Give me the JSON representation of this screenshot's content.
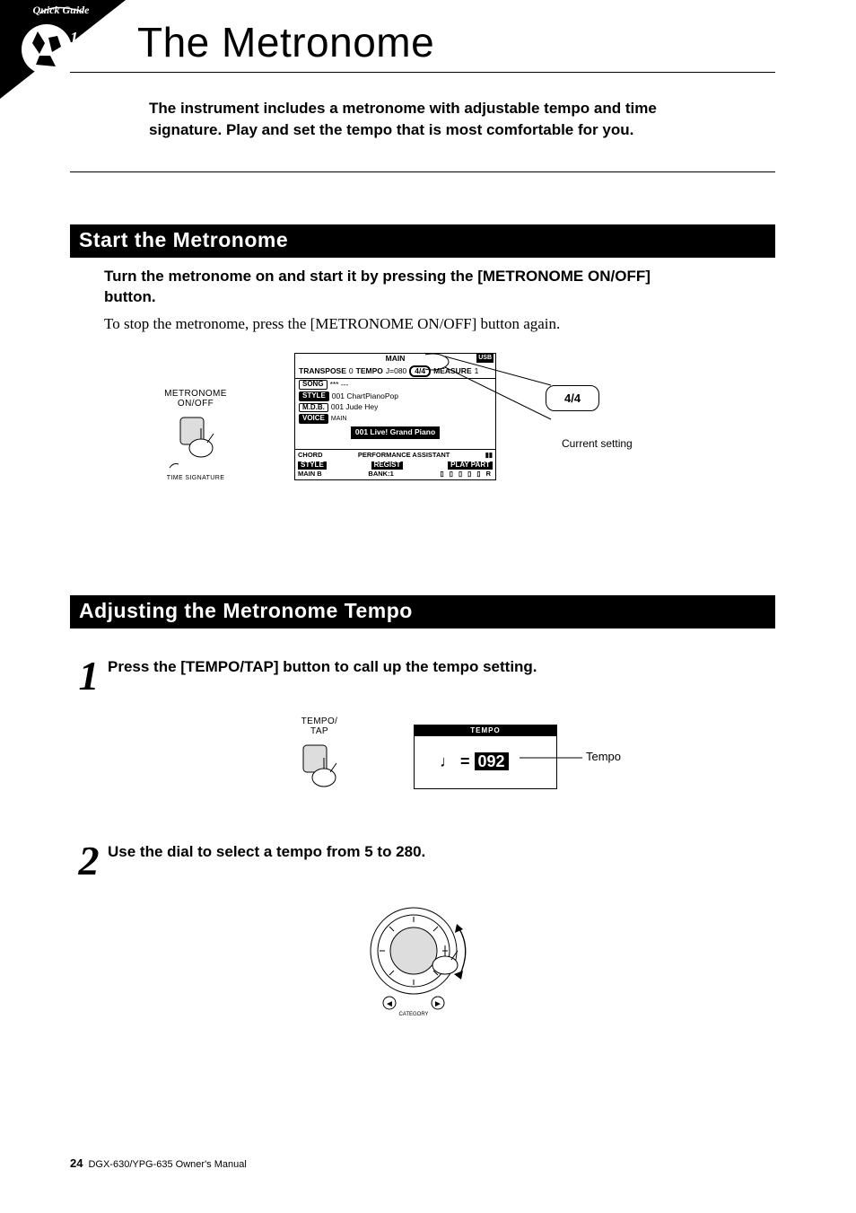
{
  "page": {
    "title": "The Metronome",
    "intro": "The instrument includes a metronome with adjustable tempo and time signature. Play and set the tempo that is most comfortable for you.",
    "page_number": "24",
    "footer": "DGX-630/YPG-635  Owner's Manual"
  },
  "section1": {
    "heading": "Start the Metronome",
    "bold_para": "Turn the metronome on and start it by pressing the [METRONOME ON/OFF] button.",
    "reg_para": "To stop the metronome, press the [METRONOME ON/OFF] button again.",
    "button_label_line1": "METRONOME",
    "button_label_line2": "ON/OFF",
    "button_footnote": "TIME SIGNATURE",
    "callout_value": "4/4",
    "callout_label": "Current setting"
  },
  "lcd": {
    "title": "MAIN",
    "transpose_label": "TRANSPOSE",
    "transpose_value": "0",
    "tempo_label": "TEMPO",
    "tempo_value": "J=080",
    "timesig": "4/4",
    "measure_label": "MEASURE",
    "measure_value": "1",
    "song_label": "SONG",
    "song_value": "*** ---",
    "style_label": "STYLE",
    "style_value": "001 ChartPianoPop",
    "mdb_label": "M.D.B.",
    "mdb_value": "001 Jude Hey",
    "voice_label": "VOICE",
    "voice_sub": "MAIN",
    "voice_value": "001 Live! Grand Piano",
    "chord_label": "CHORD",
    "perf_label": "PERFORMANCE ASSISTANT",
    "style_section": "STYLE",
    "mainb": "MAIN B",
    "regist": "REGIST",
    "bank": "BANK:1",
    "playpart": "PLAY PART"
  },
  "section2": {
    "heading": "Adjusting the Metronome Tempo",
    "step1_num": "1",
    "step1_text": "Press the [TEMPO/TAP] button to call up the tempo setting.",
    "step2_num": "2",
    "step2_text": "Use the dial to select a tempo from 5 to 280.",
    "tempo_button_line1": "TEMPO/",
    "tempo_button_line2": "TAP",
    "tempo_lcd_title": "TEMPO",
    "tempo_lcd_value": "092",
    "tempo_callout": "Tempo",
    "dial_footnote": "CATEGORY"
  }
}
